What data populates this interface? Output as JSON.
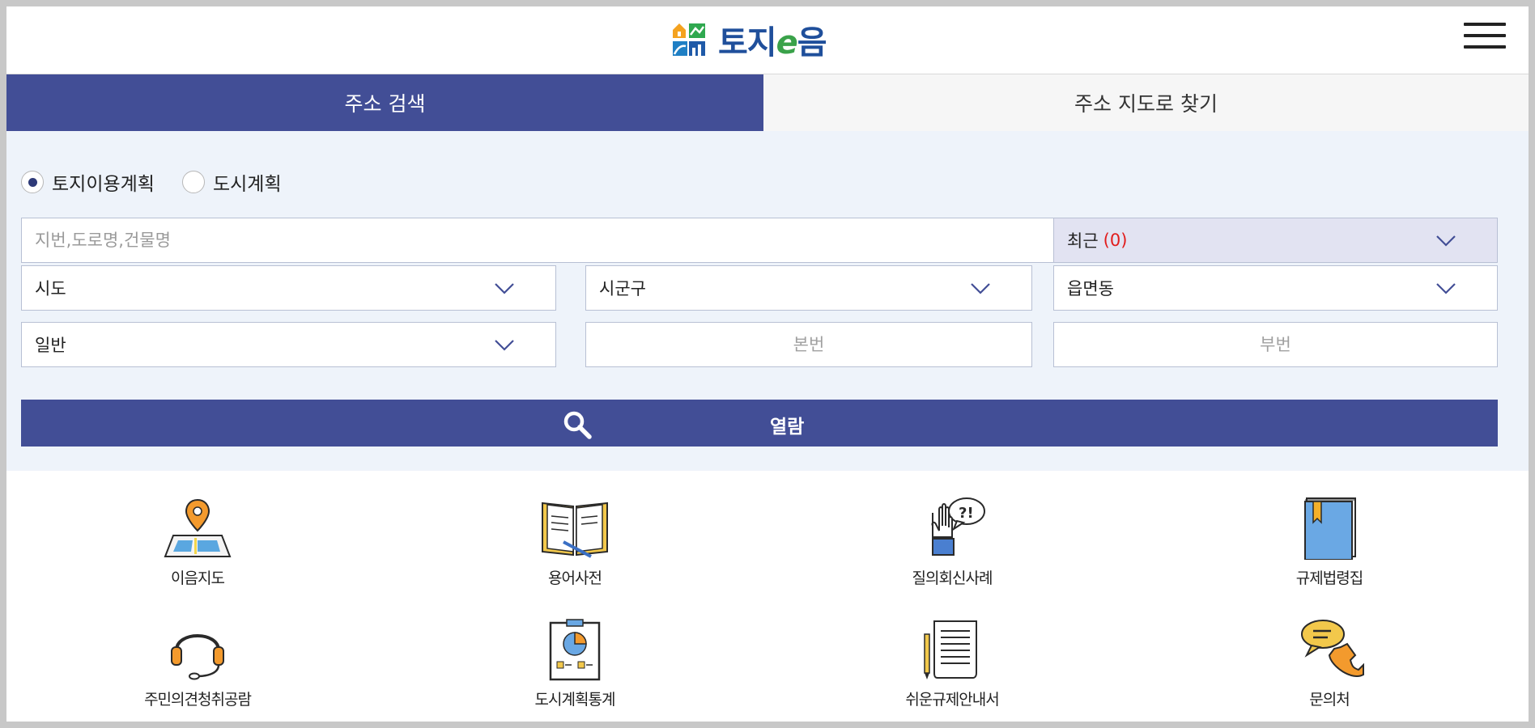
{
  "header": {
    "logo_text_1": "토지",
    "logo_text_e": "e",
    "logo_text_2": "음"
  },
  "tabs": [
    {
      "label": "주소 검색",
      "active": true
    },
    {
      "label": "주소 지도로 찾기",
      "active": false
    }
  ],
  "search": {
    "radio_options": [
      {
        "label": "토지이용계획",
        "checked": true
      },
      {
        "label": "도시계획",
        "checked": false
      }
    ],
    "address_placeholder": "지번,도로명,건물명",
    "recent_label": "최근",
    "recent_count": "(0)",
    "sido": "시도",
    "sigungu": "시군구",
    "eupmyeondong": "읍면동",
    "land_type": "일반",
    "main_number_placeholder": "본번",
    "sub_number_placeholder": "부번",
    "view_button": "열람"
  },
  "quick_menu": [
    {
      "label": "이음지도",
      "icon": "map-pin-icon"
    },
    {
      "label": "용어사전",
      "icon": "open-book-icon"
    },
    {
      "label": "질의회신사례",
      "icon": "question-hand-icon"
    },
    {
      "label": "규제법령집",
      "icon": "law-book-icon"
    },
    {
      "label": "주민의견청취공람",
      "icon": "headset-icon"
    },
    {
      "label": "도시계획통계",
      "icon": "statistics-board-icon"
    },
    {
      "label": "쉬운규제안내서",
      "icon": "document-scroll-icon"
    },
    {
      "label": "문의처",
      "icon": "phone-chat-icon"
    }
  ],
  "colors": {
    "primary": "#424e96",
    "panel_bg": "#eef3fa",
    "recent_bg": "#e2e3f2",
    "recent_count": "#e11d1d"
  }
}
